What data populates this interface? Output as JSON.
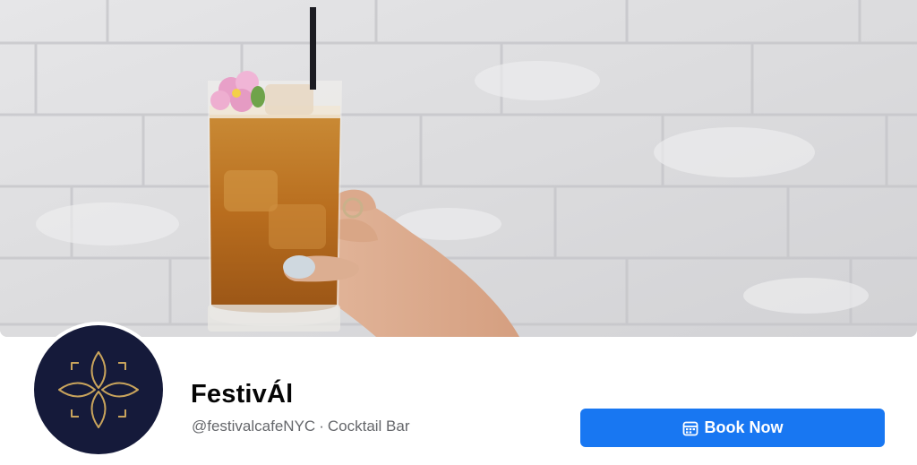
{
  "page": {
    "name": "FestivÁl",
    "username": "@festivalcafeNYC",
    "separator": "·",
    "category": "Cocktail Bar"
  },
  "actions": {
    "book_label": "Book Now",
    "book_icon": "calendar-icon"
  },
  "cover": {
    "subject": "cover-photo"
  },
  "avatar": {
    "logo": "gold-diamond-logo"
  },
  "colors": {
    "primary_button": "#1877f2",
    "avatar_background": "#151a3a",
    "logo_gold": "#c9a45c",
    "name_text": "#050505",
    "secondary_text": "#65676b"
  }
}
